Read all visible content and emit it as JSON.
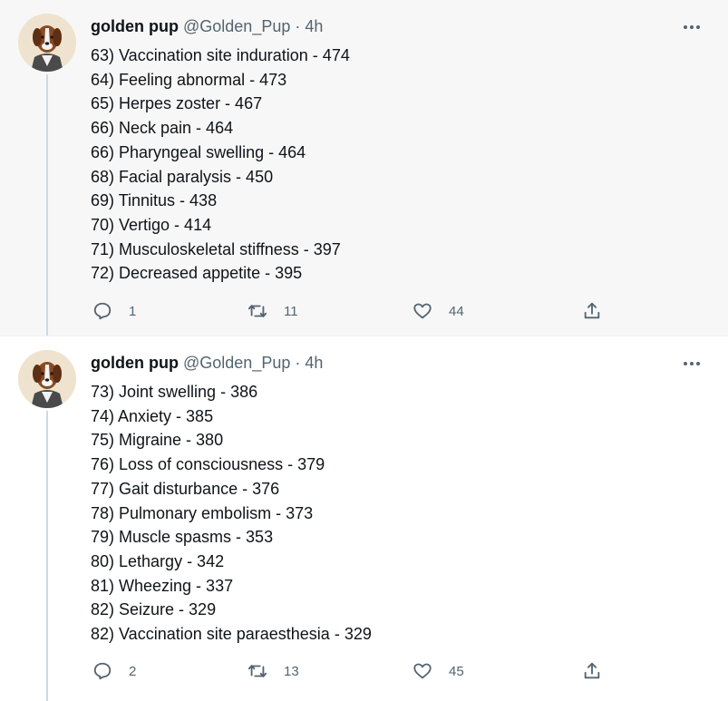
{
  "tweets": [
    {
      "name": "golden pup",
      "handle": "@Golden_Pup",
      "separator": "·",
      "time": "4h",
      "lines": [
        "63) Vaccination site induration - 474",
        "64) Feeling abnormal - 473",
        "65) Herpes zoster - 467",
        "66) Neck pain - 464",
        "66) Pharyngeal swelling - 464",
        "68) Facial paralysis - 450",
        "69) Tinnitus - 438",
        "70) Vertigo - 414",
        "71) Musculoskeletal stiffness - 397",
        "72) Decreased appetite - 395"
      ],
      "replies": "1",
      "retweets": "11",
      "likes": "44"
    },
    {
      "name": "golden pup",
      "handle": "@Golden_Pup",
      "separator": "·",
      "time": "4h",
      "lines": [
        "73) Joint swelling - 386",
        "74) Anxiety - 385",
        "75) Migraine - 380",
        "76) Loss of consciousness - 379",
        "77) Gait disturbance - 376",
        "78) Pulmonary embolism - 373",
        "79) Muscle spasms - 353",
        "80) Lethargy - 342",
        "81) Wheezing - 337",
        "82) Seizure - 329",
        "82) Vaccination site paraesthesia - 329"
      ],
      "replies": "2",
      "retweets": "13",
      "likes": "45"
    }
  ],
  "icons": {
    "more": "more-horizontal-icon",
    "reply": "reply-icon",
    "retweet": "retweet-icon",
    "like": "heart-icon",
    "share": "share-icon"
  },
  "colors": {
    "text": "#0f1419",
    "secondary": "#536471",
    "thread_line": "#cfd9de",
    "highlight_bg": "#f7f7f7"
  }
}
